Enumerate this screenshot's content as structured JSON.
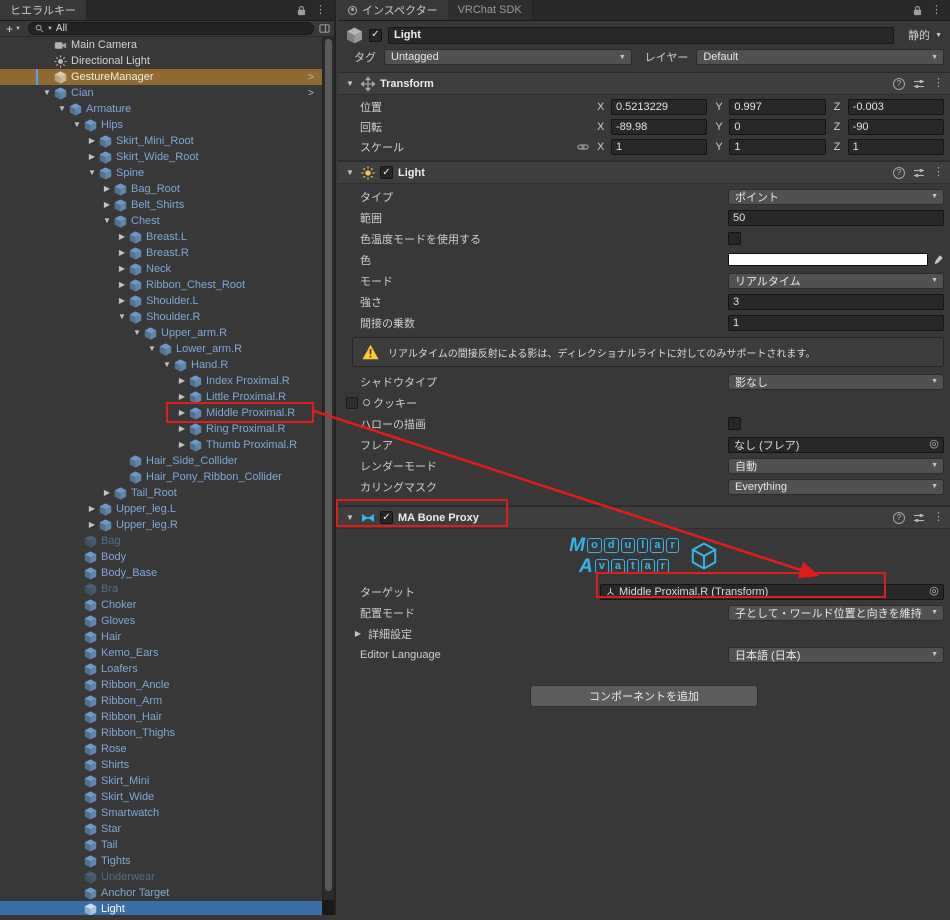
{
  "colors": {
    "annotation_red": "#e21b1b",
    "selection_blue": "#3a6ea5",
    "highlight_orange": "#8f6a33",
    "prefab_text_blue": "#7fa8d8",
    "ma_logo_blue": "#35b5ee",
    "warning_yellow": "#ffc933",
    "color_swatch": "#ffffff"
  },
  "hierarchy": {
    "tab_label": "ヒエラルキー",
    "toolbar": {
      "add_label": "+",
      "search_value": "All"
    },
    "items": [
      {
        "label": "Main Camera",
        "level": 0,
        "arrow": "none",
        "icon": "camera",
        "state": "normal"
      },
      {
        "label": "Directional Light",
        "level": 0,
        "arrow": "none",
        "icon": "sun",
        "state": "normal"
      },
      {
        "label": "GestureManager",
        "level": 0,
        "arrow": "none",
        "icon": "cube",
        "state": "highlight",
        "chevron": true
      },
      {
        "label": "Cian",
        "level": 0,
        "arrow": "down",
        "icon": "cube",
        "state": "prefab",
        "chevron": true
      },
      {
        "label": "Armature",
        "level": 1,
        "arrow": "down",
        "icon": "cube",
        "state": "prefab"
      },
      {
        "label": "Hips",
        "level": 2,
        "arrow": "down",
        "icon": "cube",
        "state": "prefab"
      },
      {
        "label": "Skirt_Mini_Root",
        "level": 3,
        "arrow": "right",
        "icon": "cube",
        "state": "prefab"
      },
      {
        "label": "Skirt_Wide_Root",
        "level": 3,
        "arrow": "right",
        "icon": "cube",
        "state": "prefab"
      },
      {
        "label": "Spine",
        "level": 3,
        "arrow": "down",
        "icon": "cube",
        "state": "prefab"
      },
      {
        "label": "Bag_Root",
        "level": 4,
        "arrow": "right",
        "icon": "cube",
        "state": "prefab"
      },
      {
        "label": "Belt_Shirts",
        "level": 4,
        "arrow": "right",
        "icon": "cube",
        "state": "prefab"
      },
      {
        "label": "Chest",
        "level": 4,
        "arrow": "down",
        "icon": "cube",
        "state": "prefab"
      },
      {
        "label": "Breast.L",
        "level": 5,
        "arrow": "right",
        "icon": "cube",
        "state": "prefab"
      },
      {
        "label": "Breast.R",
        "level": 5,
        "arrow": "right",
        "icon": "cube",
        "state": "prefab"
      },
      {
        "label": "Neck",
        "level": 5,
        "arrow": "right",
        "icon": "cube",
        "state": "prefab"
      },
      {
        "label": "Ribbon_Chest_Root",
        "level": 5,
        "arrow": "right",
        "icon": "cube",
        "state": "prefab"
      },
      {
        "label": "Shoulder.L",
        "level": 5,
        "arrow": "right",
        "icon": "cube",
        "state": "prefab"
      },
      {
        "label": "Shoulder.R",
        "level": 5,
        "arrow": "down",
        "icon": "cube",
        "state": "prefab"
      },
      {
        "label": "Upper_arm.R",
        "level": 6,
        "arrow": "down",
        "icon": "cube",
        "state": "prefab"
      },
      {
        "label": "Lower_arm.R",
        "level": 7,
        "arrow": "down",
        "icon": "cube",
        "state": "prefab"
      },
      {
        "label": "Hand.R",
        "level": 8,
        "arrow": "down",
        "icon": "cube",
        "state": "prefab"
      },
      {
        "label": "Index Proximal.R",
        "level": 9,
        "arrow": "right",
        "icon": "cube",
        "state": "prefab"
      },
      {
        "label": "Little Proximal.R",
        "level": 9,
        "arrow": "right",
        "icon": "cube",
        "state": "prefab"
      },
      {
        "label": "Middle Proximal.R",
        "level": 9,
        "arrow": "right",
        "icon": "cube",
        "state": "prefab",
        "boxed": true
      },
      {
        "label": "Ring Proximal.R",
        "level": 9,
        "arrow": "right",
        "icon": "cube",
        "state": "prefab"
      },
      {
        "label": "Thumb Proximal.R",
        "level": 9,
        "arrow": "right",
        "icon": "cube",
        "state": "prefab"
      },
      {
        "label": "Hair_Side_Collider",
        "level": 5,
        "arrow": "none",
        "icon": "cube",
        "state": "prefab"
      },
      {
        "label": "Hair_Pony_Ribbon_Collider",
        "level": 5,
        "arrow": "none",
        "icon": "cube",
        "state": "prefab"
      },
      {
        "label": "Tail_Root",
        "level": 4,
        "arrow": "right",
        "icon": "cube",
        "state": "prefab"
      },
      {
        "label": "Upper_leg.L",
        "level": 3,
        "arrow": "right",
        "icon": "cube",
        "state": "prefab"
      },
      {
        "label": "Upper_leg.R",
        "level": 3,
        "arrow": "right",
        "icon": "cube",
        "state": "prefab"
      },
      {
        "label": "Bag",
        "level": 2,
        "arrow": "none",
        "icon": "cube",
        "state": "disabled"
      },
      {
        "label": "Body",
        "level": 2,
        "arrow": "none",
        "icon": "cube",
        "state": "prefab"
      },
      {
        "label": "Body_Base",
        "level": 2,
        "arrow": "none",
        "icon": "cube",
        "state": "prefab"
      },
      {
        "label": "Bra",
        "level": 2,
        "arrow": "none",
        "icon": "cube",
        "state": "disabled"
      },
      {
        "label": "Choker",
        "level": 2,
        "arrow": "none",
        "icon": "cube",
        "state": "prefab"
      },
      {
        "label": "Gloves",
        "level": 2,
        "arrow": "none",
        "icon": "cube",
        "state": "prefab"
      },
      {
        "label": "Hair",
        "level": 2,
        "arrow": "none",
        "icon": "cube",
        "state": "prefab"
      },
      {
        "label": "Kemo_Ears",
        "level": 2,
        "arrow": "none",
        "icon": "cube",
        "state": "prefab"
      },
      {
        "label": "Loafers",
        "level": 2,
        "arrow": "none",
        "icon": "cube",
        "state": "prefab"
      },
      {
        "label": "Ribbon_Ancle",
        "level": 2,
        "arrow": "none",
        "icon": "cube",
        "state": "prefab"
      },
      {
        "label": "Ribbon_Arm",
        "level": 2,
        "arrow": "none",
        "icon": "cube",
        "state": "prefab"
      },
      {
        "label": "Ribbon_Hair",
        "level": 2,
        "arrow": "none",
        "icon": "cube",
        "state": "prefab"
      },
      {
        "label": "Ribbon_Thighs",
        "level": 2,
        "arrow": "none",
        "icon": "cube",
        "state": "prefab"
      },
      {
        "label": "Rose",
        "level": 2,
        "arrow": "none",
        "icon": "cube",
        "state": "prefab"
      },
      {
        "label": "Shirts",
        "level": 2,
        "arrow": "none",
        "icon": "cube",
        "state": "prefab"
      },
      {
        "label": "Skirt_Mini",
        "level": 2,
        "arrow": "none",
        "icon": "cube",
        "state": "prefab"
      },
      {
        "label": "Skirt_Wide",
        "level": 2,
        "arrow": "none",
        "icon": "cube",
        "state": "prefab"
      },
      {
        "label": "Smartwatch",
        "level": 2,
        "arrow": "none",
        "icon": "cube",
        "state": "prefab"
      },
      {
        "label": "Star",
        "level": 2,
        "arrow": "none",
        "icon": "cube",
        "state": "prefab"
      },
      {
        "label": "Tail",
        "level": 2,
        "arrow": "none",
        "icon": "cube",
        "state": "prefab"
      },
      {
        "label": "Tights",
        "level": 2,
        "arrow": "none",
        "icon": "cube",
        "state": "prefab"
      },
      {
        "label": "Underwear",
        "level": 2,
        "arrow": "none",
        "icon": "cube",
        "state": "disabled"
      },
      {
        "label": "Anchor Target",
        "level": 2,
        "arrow": "none",
        "icon": "cube",
        "state": "prefab"
      },
      {
        "label": "Light",
        "level": 2,
        "arrow": "none",
        "icon": "cube",
        "state": "selected"
      }
    ]
  },
  "inspector": {
    "tabs": [
      {
        "label": "インスペクター"
      },
      {
        "label": "VRChat SDK"
      }
    ],
    "header": {
      "name": "Light",
      "static_label": "静的",
      "tag_label": "タグ",
      "tag_value": "Untagged",
      "layer_label": "レイヤー",
      "layer_value": "Default"
    },
    "transform": {
      "title": "Transform",
      "axis": {
        "x": "X",
        "y": "Y",
        "z": "Z"
      },
      "position": {
        "label": "位置",
        "x": "0.5213229",
        "y": "0.997",
        "z": "-0.003"
      },
      "rotation": {
        "label": "回転",
        "x": "-89.98",
        "y": "0",
        "z": "-90"
      },
      "scale": {
        "label": "スケール",
        "x": "1",
        "y": "1",
        "z": "1"
      }
    },
    "light": {
      "title": "Light",
      "type_label": "タイプ",
      "type_value": "ポイント",
      "range_label": "範囲",
      "range_value": "50",
      "color_temp_label": "色温度モードを使用する",
      "color_label": "色",
      "mode_label": "モード",
      "mode_value": "リアルタイム",
      "intensity_label": "強さ",
      "intensity_value": "3",
      "indirect_label": "間接の乗数",
      "indirect_value": "1",
      "warning": "リアルタイムの間接反射による影は、ディレクショナルライトに対してのみサポートされます。",
      "shadow_label": "シャドウタイプ",
      "shadow_value": "影なし",
      "cookie_label": "クッキー",
      "halo_label": "ハローの描画",
      "flare_label": "フレア",
      "flare_value": "なし (フレア)",
      "render_mode_label": "レンダーモード",
      "render_mode_value": "自動",
      "culling_label": "カリングマスク",
      "culling_value": "Everything"
    },
    "bone_proxy": {
      "title": "MA Bone Proxy",
      "logo_line1": "Modular",
      "logo_line2": "Avatar",
      "target_label": "ターゲット",
      "target_value": "Middle Proximal.R (Transform)",
      "placement_label": "配置モード",
      "placement_value": "子として・ワールド位置と向きを維持",
      "advanced_label": "詳細設定",
      "language_label": "Editor Language",
      "language_value": "日本語 (日本)"
    },
    "add_component_label": "コンポーネントを追加"
  }
}
